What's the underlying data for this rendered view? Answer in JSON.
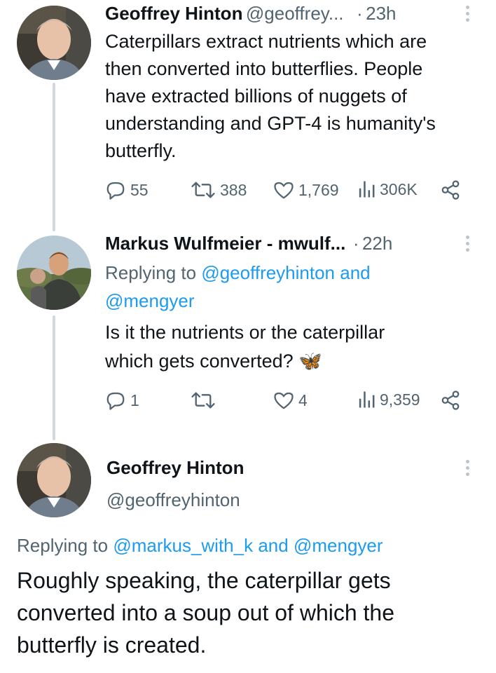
{
  "tweet1": {
    "display_name": "Geoffrey Hinton",
    "handle": "@geoffrey...",
    "separator": "·",
    "time": "23h",
    "lines": [
      "Caterpillars extract nutrients which are",
      "then converted into butterflies. People",
      "have extracted billions of nuggets of",
      "understanding and GPT-4 is humanity's",
      "butterfly."
    ],
    "replies": "55",
    "retweets": "388",
    "likes": "1,769",
    "views": "306K"
  },
  "tweet2": {
    "display_name": "Markus Wulfmeier - mwulf...",
    "separator": "·",
    "time": "22h",
    "replying_prefix": "Replying to",
    "mention1": "@geoffreyhinton",
    "and_word": "and",
    "mention2": "@mengyer",
    "lines": [
      "Is it the nutrients or the caterpillar",
      "which gets converted?"
    ],
    "emoji": "🦋",
    "replies": "1",
    "retweets": "",
    "likes": "4",
    "views": "9,359"
  },
  "tweet3": {
    "display_name": "Geoffrey Hinton",
    "handle": "@geoffreyhinton",
    "replying_prefix": "Replying to",
    "mention1": "@markus_with_k",
    "and_word": "and",
    "mention2": "@mengyer",
    "lines": [
      "Roughly speaking, the caterpillar gets",
      "converted into a soup out of which the",
      "butterfly is created."
    ]
  },
  "colors": {
    "text": "#0f1419",
    "secondary": "#536471",
    "link": "#1d9bf0",
    "thread_line": "#cfd9de"
  },
  "icons": [
    "reply-icon",
    "retweet-icon",
    "like-icon",
    "views-icon",
    "share-icon",
    "more-icon",
    "butterfly-emoji"
  ]
}
